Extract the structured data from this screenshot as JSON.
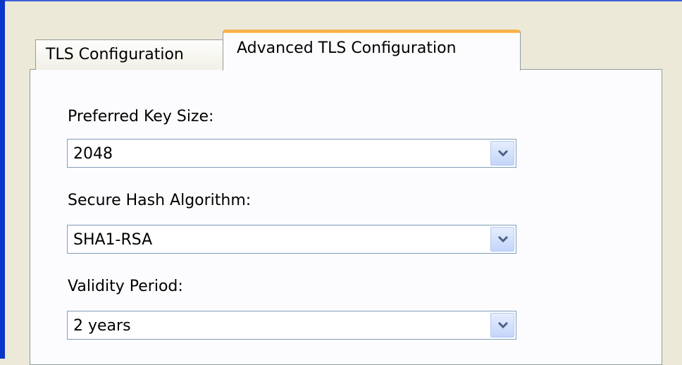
{
  "tabs": [
    {
      "label": "TLS Configuration",
      "selected": false
    },
    {
      "label": "Advanced TLS Configuration",
      "selected": true
    }
  ],
  "fields": [
    {
      "label": "Preferred Key Size:",
      "value": "2048"
    },
    {
      "label": "Secure Hash Algorithm:",
      "value": "SHA1-RSA"
    },
    {
      "label": "Validity Period:",
      "value": "2 years"
    }
  ],
  "icons": {
    "dropdown": "chevron-down-icon"
  },
  "colors": {
    "active_tab_accent": "#f7b24a",
    "combo_border": "#7f9db9"
  }
}
